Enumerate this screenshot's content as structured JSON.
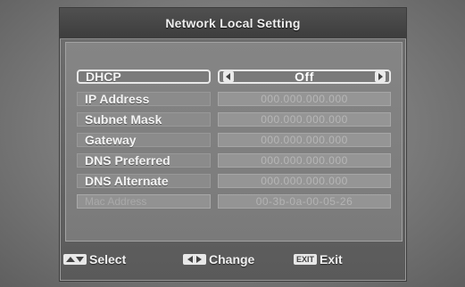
{
  "title": "Network Local Setting",
  "rows": [
    {
      "label": "DHCP",
      "value": "Off"
    },
    {
      "label": "IP Address",
      "value": "000.000.000.000"
    },
    {
      "label": "Subnet Mask",
      "value": "000.000.000.000"
    },
    {
      "label": "Gateway",
      "value": "000.000.000.000"
    },
    {
      "label": "DNS Preferred",
      "value": "000.000.000.000"
    },
    {
      "label": "DNS Alternate",
      "value": "000.000.000.000"
    },
    {
      "label": "Mac Address",
      "value": "00-3b-0a-00-05-26"
    }
  ],
  "footer": {
    "select_label": "Select",
    "change_label": "Change",
    "exit_key": "EXIT",
    "exit_label": "Exit"
  },
  "icons": {
    "select": "up-down-arrows-icon",
    "change": "left-right-arrows-icon",
    "exit": "exit-key-icon",
    "value_left": "left-arrow-icon",
    "value_right": "right-arrow-icon"
  }
}
